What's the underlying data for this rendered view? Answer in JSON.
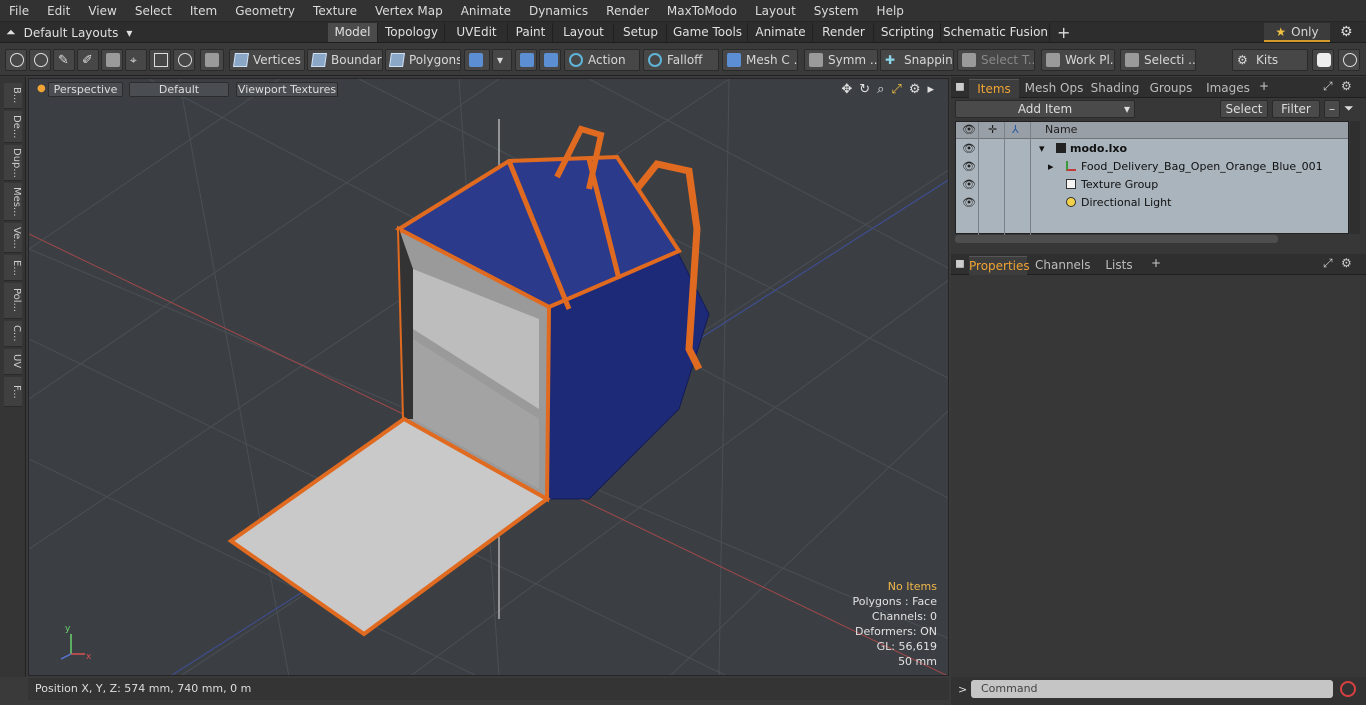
{
  "menu": [
    "File",
    "Edit",
    "View",
    "Select",
    "Item",
    "Geometry",
    "Texture",
    "Vertex Map",
    "Animate",
    "Dynamics",
    "Render",
    "MaxToModo",
    "Layout",
    "System",
    "Help"
  ],
  "layouts_label": "Default Layouts",
  "tabs": [
    "Model",
    "Topology",
    "UVEdit",
    "Paint",
    "Layout",
    "Setup",
    "Game Tools",
    "Animate",
    "Render",
    "Scripting",
    "Schematic Fusion"
  ],
  "active_tab": "Model",
  "only_label": "Only",
  "toolbar": {
    "vertices": "Vertices",
    "boundary": "Boundary",
    "polygons": "Polygons",
    "action": "Action",
    "falloff": "Falloff",
    "mesh_c": "Mesh C ...",
    "symm": "Symm ...",
    "snapping": "Snapping",
    "select_t": "Select T...",
    "work_pl": "Work Pl...",
    "selecti": "Selecti ...",
    "kits": "Kits"
  },
  "left_strip": [
    "B...",
    "De...",
    "Dup...",
    "Mes...",
    "Ve...",
    "E...",
    "Pol...",
    "C...",
    "UV",
    "F..."
  ],
  "viewport": {
    "view_mode": "Perspective",
    "shading": "Default",
    "textures": "Viewport Textures",
    "stats": {
      "no_items": "No Items",
      "polygons": "Polygons : Face",
      "channels": "Channels: 0",
      "deformers": "Deformers: ON",
      "gl": "GL: 56,619",
      "size": "50 mm"
    }
  },
  "status": "Position X, Y, Z:  574 mm, 740 mm, 0 m",
  "right_panel": {
    "top_tabs": [
      "Items",
      "Mesh Ops",
      "Shading",
      "Groups",
      "Images"
    ],
    "add_item": "Add Item",
    "select": "Select",
    "filter": "Filter",
    "name_col": "Name",
    "items": [
      {
        "label": "modo.lxo",
        "bold": true
      },
      {
        "label": "Food_Delivery_Bag_Open_Orange_Blue_001"
      },
      {
        "label": "Texture Group"
      },
      {
        "label": "Directional Light"
      }
    ],
    "bottom_tabs": [
      "Properties",
      "Channels",
      "Lists"
    ],
    "command_placeholder": "Command"
  },
  "colors": {
    "accent": "#f0a433",
    "bag_blue": "#1d2a78",
    "bag_orange": "#e06a1f"
  }
}
